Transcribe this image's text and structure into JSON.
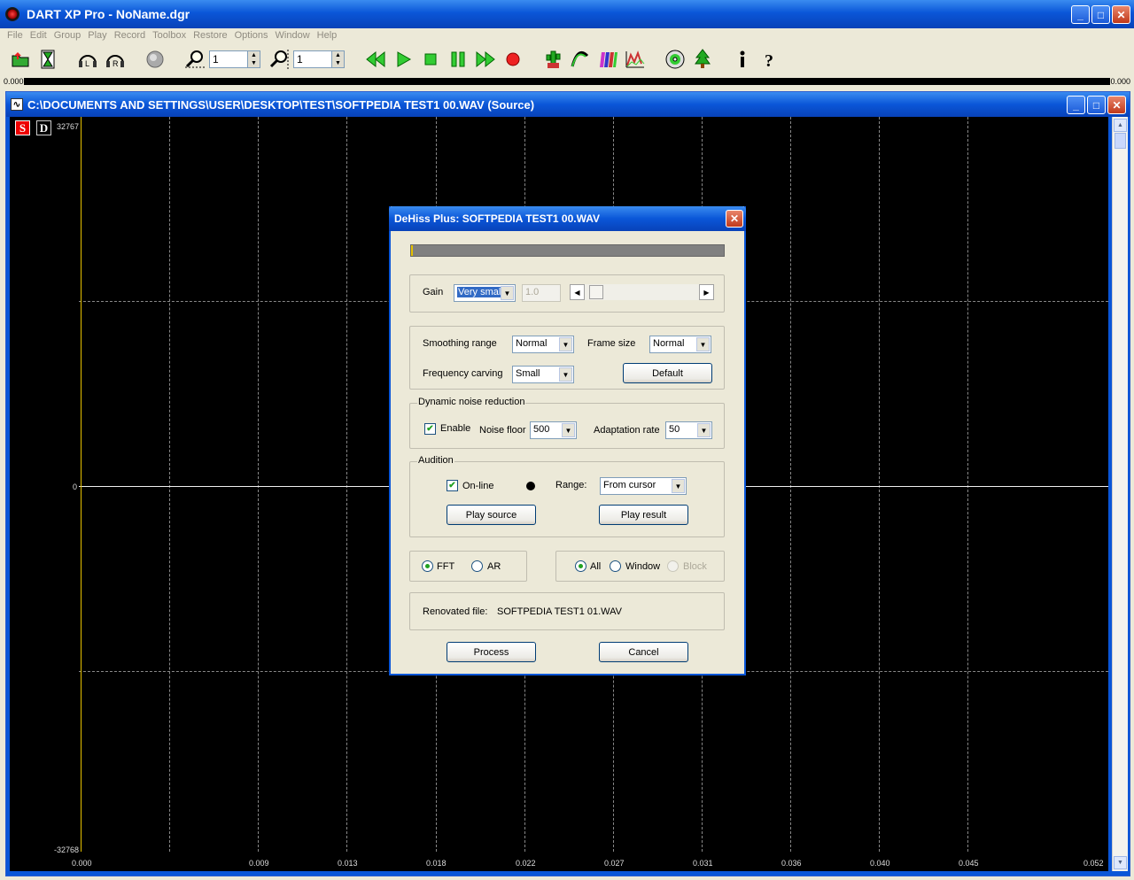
{
  "app": {
    "title": "DART XP Pro - NoName.dgr",
    "min": "_",
    "max": "□",
    "close": "✕"
  },
  "menu": [
    "File",
    "Edit",
    "Group",
    "Play",
    "Record",
    "Toolbox",
    "Restore",
    "Options",
    "Window",
    "Help"
  ],
  "toolbar": {
    "zoom_x": "1",
    "zoom_y": "1"
  },
  "ruler": {
    "left": "0.000",
    "right": "0.000"
  },
  "doc": {
    "title": "C:\\DOCUMENTS AND SETTINGS\\USER\\DESKTOP\\TEST\\SOFTPEDIA TEST1 00.WAV (Source)",
    "s": "S",
    "d": "D"
  },
  "plot": {
    "y_top": "32767",
    "y_mid": "0",
    "y_bottom": "-32768",
    "x_ticks": [
      "0.000",
      "0.009",
      "0.013",
      "0.018",
      "0.022",
      "0.027",
      "0.031",
      "0.036",
      "0.040",
      "0.045",
      "0.052"
    ]
  },
  "dialog": {
    "title": "DeHiss Plus: SOFTPEDIA TEST1 00.WAV",
    "progress": 0.0,
    "gain_label": "Gain",
    "gain_value": "Very small",
    "gain_number": "1.0",
    "smoothing_label": "Smoothing range",
    "smoothing_value": "Normal",
    "frame_label": "Frame size",
    "frame_value": "Normal",
    "carving_label": "Frequency carving",
    "carving_value": "Small",
    "default_button": "Default",
    "dnr_group": "Dynamic noise reduction",
    "enable_label": "Enable",
    "noise_floor_label": "Noise floor",
    "noise_floor_value": "500",
    "adaptation_label": "Adaptation rate",
    "adaptation_value": "50",
    "audition_group": "Audition",
    "online_label": "On-line",
    "range_label": "Range:",
    "range_value": "From cursor",
    "play_source": "Play source",
    "play_result": "Play result",
    "fft_label": "FFT",
    "ar_label": "AR",
    "all_label": "All",
    "window_label": "Window",
    "block_label": "Block",
    "renovated_label": "Renovated file:",
    "renovated_value": "SOFTPEDIA TEST1 01.WAV",
    "process_button": "Process",
    "cancel_button": "Cancel"
  }
}
